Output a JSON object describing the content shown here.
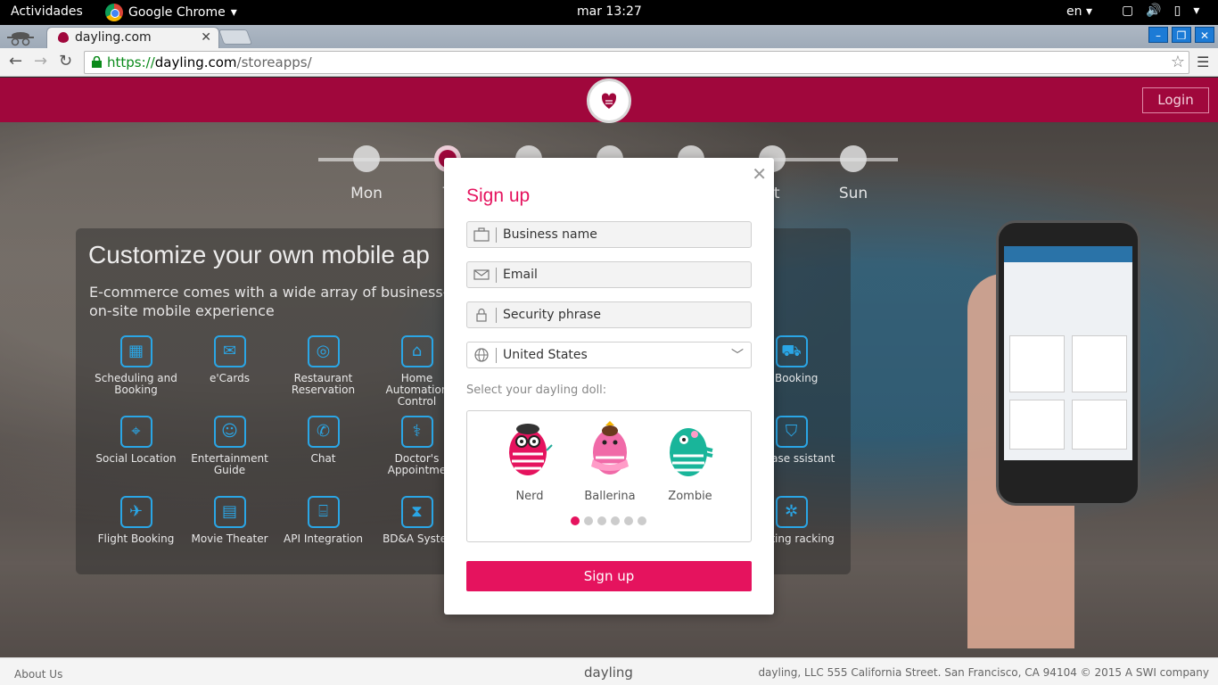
{
  "system": {
    "activities": "Actividades",
    "app_name": "Google Chrome",
    "clock": "mar 13:27",
    "lang": "en"
  },
  "browser": {
    "tab_title": "dayling.com",
    "url_scheme": "https://",
    "url_host": "dayling.com",
    "url_path": "/storeapps/"
  },
  "site": {
    "login_label": "Login",
    "days": [
      "Mon",
      "T",
      "",
      "",
      "",
      "at",
      "Sun"
    ],
    "headline": "Customize your own mobile ap",
    "subline": "E-commerce comes with a wide array of business-o on-site mobile experience",
    "features": [
      {
        "label": "Scheduling and Booking",
        "icon": "calendar-icon"
      },
      {
        "label": "e'Cards",
        "icon": "ecard-icon"
      },
      {
        "label": "Restaurant Reservation",
        "icon": "restaurant-icon"
      },
      {
        "label": "Home Automation Control",
        "icon": "home-icon"
      },
      {
        "label": "Social Location",
        "icon": "location-pin-icon"
      },
      {
        "label": "Entertainment Guide",
        "icon": "theater-masks-icon"
      },
      {
        "label": "Chat",
        "icon": "chat-icon"
      },
      {
        "label": "Doctor's Appointme",
        "icon": "stethoscope-icon"
      },
      {
        "label": "Flight Booking",
        "icon": "airplane-icon"
      },
      {
        "label": "Movie Theater",
        "icon": "clapperboard-icon"
      },
      {
        "label": "API Integration",
        "icon": "api-icon"
      },
      {
        "label": "BD&A Syster",
        "icon": "hourglass-icon"
      },
      {
        "label": "d Booking",
        "icon": "taxi-icon"
      },
      {
        "label": "urchase ssistant",
        "icon": "shopping-bag-icon"
      },
      {
        "label": "Meeting racking",
        "icon": "meeting-icon"
      }
    ],
    "footer": {
      "about": "About Us",
      "brand": "dayling",
      "copyright": "dayling, LLC 555 California Street. San Francisco, CA 94104 © 2015 A SWI company"
    }
  },
  "modal": {
    "title": "Sign up",
    "fields": {
      "business_name": "Business name",
      "email": "Email",
      "security_phrase": "Security phrase",
      "country": "United States"
    },
    "doll_prompt": "Select your dayling doll:",
    "dolls": [
      {
        "name": "Nerd",
        "color": "#e5135e"
      },
      {
        "name": "Ballerina",
        "color": "#f06aa8"
      },
      {
        "name": "Zombie",
        "color": "#19b59a"
      }
    ],
    "carousel_pages": 6,
    "carousel_active": 1,
    "submit_label": "Sign up"
  },
  "colors": {
    "brand": "#a0073c",
    "accent": "#e5135e"
  }
}
